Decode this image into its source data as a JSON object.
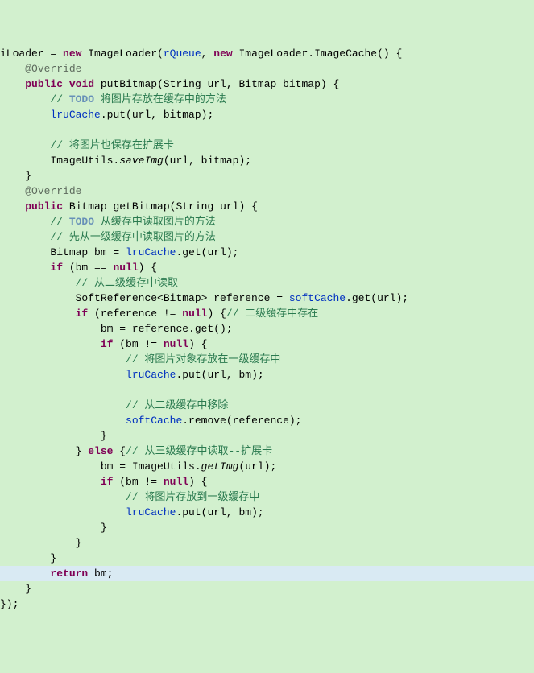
{
  "lines": [
    {
      "indent": 0,
      "bg": "normal",
      "tokens": [
        {
          "cls": "plain",
          "t": "iLoader = "
        },
        {
          "cls": "kw",
          "t": "new"
        },
        {
          "cls": "plain",
          "t": " ImageLoader("
        },
        {
          "cls": "fld",
          "t": "rQueue"
        },
        {
          "cls": "plain",
          "t": ", "
        },
        {
          "cls": "kw",
          "t": "new"
        },
        {
          "cls": "plain",
          "t": " ImageLoader.ImageCache() {"
        }
      ]
    },
    {
      "indent": 4,
      "bg": "normal",
      "tokens": [
        {
          "cls": "ann",
          "t": "@Override"
        }
      ]
    },
    {
      "indent": 4,
      "bg": "normal",
      "tokens": [
        {
          "cls": "kw",
          "t": "public"
        },
        {
          "cls": "plain",
          "t": " "
        },
        {
          "cls": "kw",
          "t": "void"
        },
        {
          "cls": "plain",
          "t": " putBitmap(String url, Bitmap bitmap) {"
        }
      ]
    },
    {
      "indent": 8,
      "bg": "normal",
      "tokens": [
        {
          "cls": "com",
          "t": "// "
        },
        {
          "cls": "todo",
          "t": "TODO"
        },
        {
          "cls": "com",
          "t": " 将图片存放在缓存中的方法"
        }
      ]
    },
    {
      "indent": 8,
      "bg": "normal",
      "tokens": [
        {
          "cls": "fld",
          "t": "lruCache"
        },
        {
          "cls": "plain",
          "t": ".put(url, bitmap);"
        }
      ]
    },
    {
      "indent": 0,
      "bg": "normal",
      "tokens": []
    },
    {
      "indent": 8,
      "bg": "normal",
      "tokens": [
        {
          "cls": "com",
          "t": "// 将图片也保存在扩展卡"
        }
      ]
    },
    {
      "indent": 8,
      "bg": "normal",
      "tokens": [
        {
          "cls": "plain",
          "t": "ImageUtils."
        },
        {
          "cls": "stat",
          "t": "saveImg"
        },
        {
          "cls": "plain",
          "t": "(url, bitmap);"
        }
      ]
    },
    {
      "indent": 4,
      "bg": "normal",
      "tokens": [
        {
          "cls": "plain",
          "t": "}"
        }
      ]
    },
    {
      "indent": 4,
      "bg": "normal",
      "tokens": [
        {
          "cls": "ann",
          "t": "@Override"
        }
      ]
    },
    {
      "indent": 4,
      "bg": "normal",
      "tokens": [
        {
          "cls": "kw",
          "t": "public"
        },
        {
          "cls": "plain",
          "t": " Bitmap getBitmap(String url) {"
        }
      ]
    },
    {
      "indent": 8,
      "bg": "normal",
      "tokens": [
        {
          "cls": "com",
          "t": "// "
        },
        {
          "cls": "todo",
          "t": "TODO"
        },
        {
          "cls": "com",
          "t": " 从缓存中读取图片的方法"
        }
      ]
    },
    {
      "indent": 8,
      "bg": "normal",
      "tokens": [
        {
          "cls": "com",
          "t": "// 先从一级缓存中读取图片的方法"
        }
      ]
    },
    {
      "indent": 8,
      "bg": "normal",
      "tokens": [
        {
          "cls": "plain",
          "t": "Bitmap bm = "
        },
        {
          "cls": "fld",
          "t": "lruCache"
        },
        {
          "cls": "plain",
          "t": ".get(url);"
        }
      ]
    },
    {
      "indent": 8,
      "bg": "normal",
      "tokens": [
        {
          "cls": "kw",
          "t": "if"
        },
        {
          "cls": "plain",
          "t": " (bm == "
        },
        {
          "cls": "kw",
          "t": "null"
        },
        {
          "cls": "plain",
          "t": ") {"
        }
      ]
    },
    {
      "indent": 12,
      "bg": "normal",
      "tokens": [
        {
          "cls": "com",
          "t": "// 从二级缓存中读取"
        }
      ]
    },
    {
      "indent": 12,
      "bg": "normal",
      "tokens": [
        {
          "cls": "plain",
          "t": "SoftReference<Bitmap> reference = "
        },
        {
          "cls": "fld",
          "t": "softCache"
        },
        {
          "cls": "plain",
          "t": ".get(url);"
        }
      ]
    },
    {
      "indent": 12,
      "bg": "normal",
      "tokens": [
        {
          "cls": "kw",
          "t": "if"
        },
        {
          "cls": "plain",
          "t": " (reference != "
        },
        {
          "cls": "kw",
          "t": "null"
        },
        {
          "cls": "plain",
          "t": ") {"
        },
        {
          "cls": "com",
          "t": "// 二级缓存中存在"
        }
      ]
    },
    {
      "indent": 16,
      "bg": "normal",
      "tokens": [
        {
          "cls": "plain",
          "t": "bm = reference.get();"
        }
      ]
    },
    {
      "indent": 16,
      "bg": "normal",
      "tokens": [
        {
          "cls": "kw",
          "t": "if"
        },
        {
          "cls": "plain",
          "t": " (bm != "
        },
        {
          "cls": "kw",
          "t": "null"
        },
        {
          "cls": "plain",
          "t": ") {"
        }
      ]
    },
    {
      "indent": 20,
      "bg": "normal",
      "tokens": [
        {
          "cls": "com",
          "t": "// 将图片对象存放在一级缓存中"
        }
      ]
    },
    {
      "indent": 20,
      "bg": "normal",
      "tokens": [
        {
          "cls": "fld",
          "t": "lruCache"
        },
        {
          "cls": "plain",
          "t": ".put(url, bm);"
        }
      ]
    },
    {
      "indent": 0,
      "bg": "normal",
      "tokens": []
    },
    {
      "indent": 20,
      "bg": "normal",
      "tokens": [
        {
          "cls": "com",
          "t": "// 从二级缓存中移除"
        }
      ]
    },
    {
      "indent": 20,
      "bg": "normal",
      "tokens": [
        {
          "cls": "fld",
          "t": "softCache"
        },
        {
          "cls": "plain",
          "t": ".remove(reference);"
        }
      ]
    },
    {
      "indent": 16,
      "bg": "normal",
      "tokens": [
        {
          "cls": "plain",
          "t": "}"
        }
      ]
    },
    {
      "indent": 12,
      "bg": "normal",
      "tokens": [
        {
          "cls": "plain",
          "t": "} "
        },
        {
          "cls": "kw",
          "t": "else"
        },
        {
          "cls": "plain",
          "t": " {"
        },
        {
          "cls": "com",
          "t": "// 从三级缓存中读取--扩展卡"
        }
      ]
    },
    {
      "indent": 16,
      "bg": "normal",
      "tokens": [
        {
          "cls": "plain",
          "t": "bm = ImageUtils."
        },
        {
          "cls": "stat",
          "t": "getImg"
        },
        {
          "cls": "plain",
          "t": "(url);"
        }
      ]
    },
    {
      "indent": 16,
      "bg": "normal",
      "tokens": [
        {
          "cls": "kw",
          "t": "if"
        },
        {
          "cls": "plain",
          "t": " (bm != "
        },
        {
          "cls": "kw",
          "t": "null"
        },
        {
          "cls": "plain",
          "t": ") {"
        }
      ]
    },
    {
      "indent": 20,
      "bg": "normal",
      "tokens": [
        {
          "cls": "com",
          "t": "// 将图片存放到一级缓存中"
        }
      ]
    },
    {
      "indent": 20,
      "bg": "normal",
      "tokens": [
        {
          "cls": "fld",
          "t": "lruCache"
        },
        {
          "cls": "plain",
          "t": ".put(url, bm);"
        }
      ]
    },
    {
      "indent": 16,
      "bg": "normal",
      "tokens": [
        {
          "cls": "plain",
          "t": "}"
        }
      ]
    },
    {
      "indent": 12,
      "bg": "normal",
      "tokens": [
        {
          "cls": "plain",
          "t": "}"
        }
      ]
    },
    {
      "indent": 8,
      "bg": "normal",
      "tokens": [
        {
          "cls": "plain",
          "t": "}"
        }
      ]
    },
    {
      "indent": 8,
      "bg": "hl",
      "tokens": [
        {
          "cls": "kw",
          "t": "return"
        },
        {
          "cls": "plain",
          "t": " bm;"
        }
      ]
    },
    {
      "indent": 4,
      "bg": "normal",
      "tokens": [
        {
          "cls": "plain",
          "t": "}"
        }
      ]
    },
    {
      "indent": 0,
      "bg": "normal",
      "tokens": [
        {
          "cls": "plain",
          "t": "});"
        }
      ]
    }
  ]
}
